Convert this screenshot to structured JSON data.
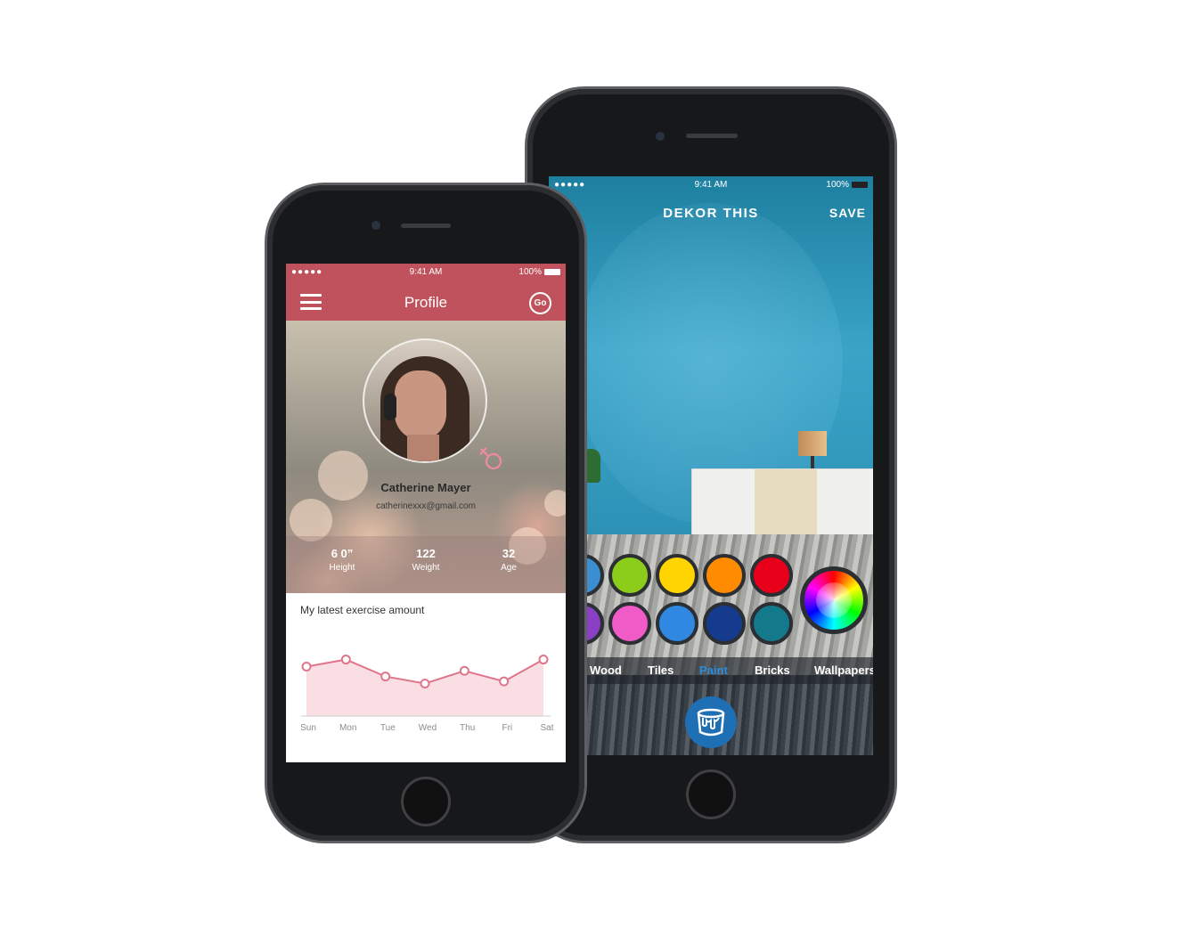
{
  "profile_app": {
    "status": {
      "signal": "●●●●● ",
      "time": "9:41 AM",
      "battery": "100%"
    },
    "header": {
      "title": "Profile",
      "go_label": "Go"
    },
    "user": {
      "name": "Catherine  Mayer",
      "email": "catherinexxx@gmail.com"
    },
    "stats": [
      {
        "value": "6 0”",
        "label": "Height"
      },
      {
        "value": "122",
        "label": "Weight"
      },
      {
        "value": "32",
        "label": "Age"
      }
    ],
    "exercise_title": "My latest exercise amount",
    "chart_data": {
      "type": "area",
      "categories": [
        "Sun",
        "Mon",
        "Tue",
        "Wed",
        "Thu",
        "Fri",
        "Sat"
      ],
      "values": [
        6,
        7,
        4.6,
        3.6,
        5.4,
        3.9,
        7
      ],
      "ylim": [
        0,
        10
      ],
      "grid": false,
      "colors": {
        "line": "#e0758b",
        "fill": "#f9dfe4",
        "point": "#e0758b"
      }
    },
    "accent_color": "#c0525d"
  },
  "dekor_app": {
    "status": {
      "signal": "●●●●● ",
      "time": "9:41 AM",
      "battery": "100%"
    },
    "header": {
      "title": "DEKOR THIS",
      "save_label": "SAVE"
    },
    "swatches_row1": [
      "#3b8fd0",
      "#8ccc1a",
      "#ffd400",
      "#ff8c00",
      "#e8001a"
    ],
    "swatches_row2": [
      "#8a3fc4",
      "#f05bc8",
      "#2f89e3",
      "#143b8e",
      "#137a8c"
    ],
    "tabs": [
      {
        "label": "Wood",
        "active": false
      },
      {
        "label": "Tiles",
        "active": false
      },
      {
        "label": "Paint",
        "active": true
      },
      {
        "label": "Bricks",
        "active": false
      },
      {
        "label": "Wallpapers",
        "active": false
      }
    ],
    "paint_icon": "paint-bucket-icon",
    "accent_color": "#2a8ee0"
  }
}
